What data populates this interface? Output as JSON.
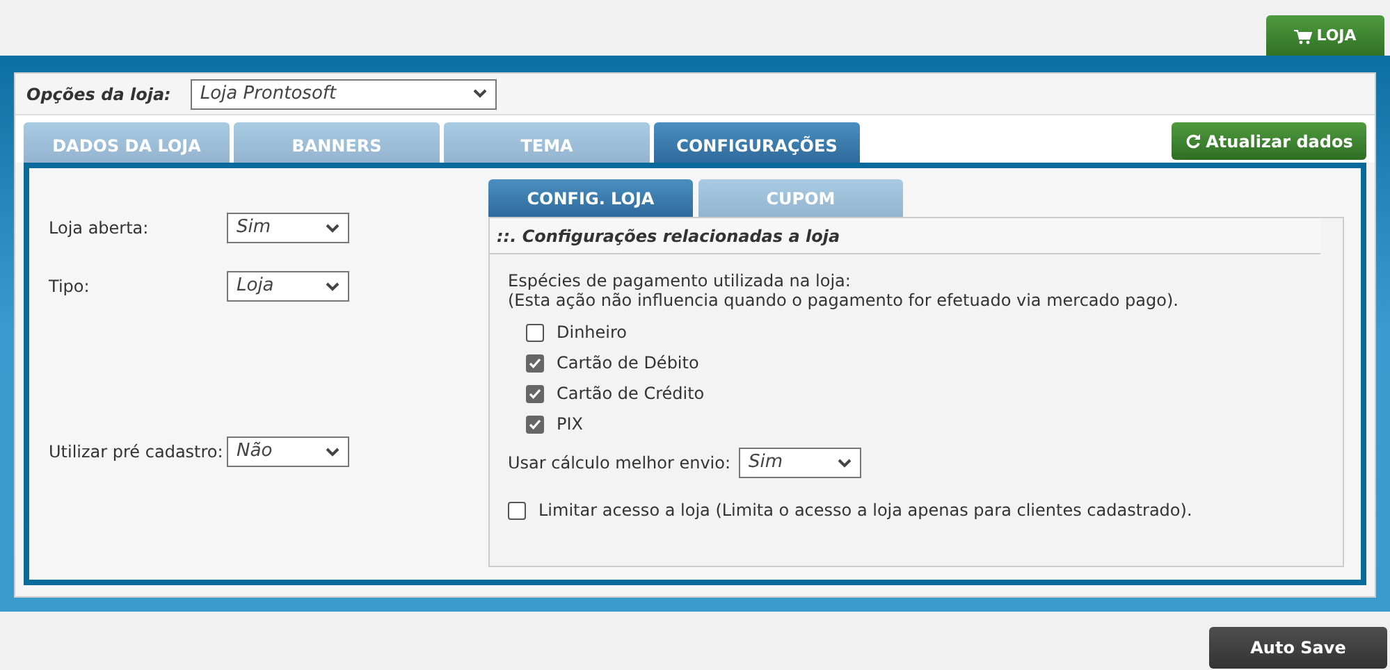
{
  "store_button": {
    "label": "LOJA"
  },
  "store_options": {
    "label": "Opções da loja:",
    "value": "Loja Prontosoft"
  },
  "tabs": [
    {
      "label": "DADOS DA LOJA",
      "selected": false
    },
    {
      "label": "BANNERS",
      "selected": false
    },
    {
      "label": "TEMA",
      "selected": false
    },
    {
      "label": "CONFIGURAÇÕES",
      "selected": true
    }
  ],
  "refresh_button": {
    "label": "Atualizar dados"
  },
  "left_fields": [
    {
      "label": "Loja aberta:",
      "value": "Sim"
    },
    {
      "label": "Tipo:",
      "value": "Loja"
    },
    {
      "label": "Utilizar pré cadastro:",
      "value": "Não"
    }
  ],
  "sub_tabs": [
    {
      "label": "CONFIG. LOJA",
      "selected": true
    },
    {
      "label": "CUPOM",
      "selected": false
    }
  ],
  "section_title": "::. Configurações relacionadas a loja",
  "payment_intro": [
    "Espécies de pagamento utilizada na loja:",
    "(Esta ação não influencia quando o pagamento for efetuado via mercado pago)."
  ],
  "payment_methods": [
    {
      "label": "Dinheiro",
      "checked": false
    },
    {
      "label": "Cartão de Débito",
      "checked": true
    },
    {
      "label": "Cartão de Crédito",
      "checked": true
    },
    {
      "label": "PIX",
      "checked": true
    }
  ],
  "shipping": {
    "label": "Usar cálculo melhor envio:",
    "value": "Sim"
  },
  "restrict_access": {
    "label": "Limitar acesso a loja (Limita o acesso a loja apenas para clientes cadastrado).",
    "checked": false
  },
  "auto_save_button": {
    "label": "Auto Save"
  }
}
